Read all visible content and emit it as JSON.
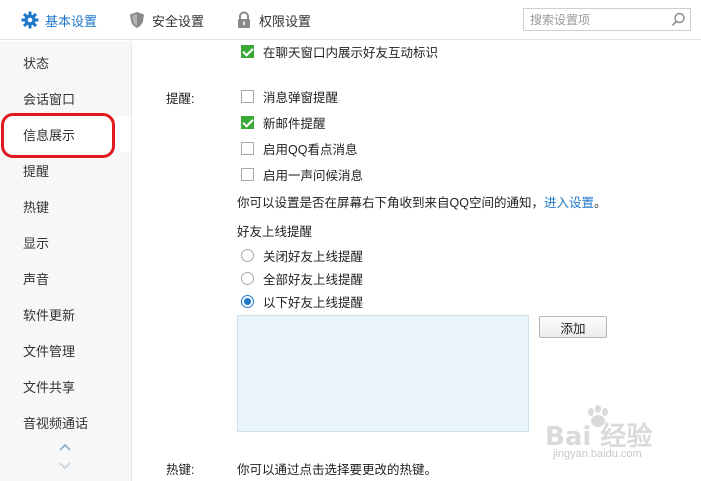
{
  "tabs": [
    {
      "label": "基本设置",
      "icon": "gear-icon",
      "active": true
    },
    {
      "label": "安全设置",
      "icon": "shield-icon",
      "active": false
    },
    {
      "label": "权限设置",
      "icon": "lock-icon",
      "active": false
    }
  ],
  "search": {
    "placeholder": "搜索设置项",
    "icon": "search-icon"
  },
  "sidebar": {
    "items": [
      {
        "label": "状态"
      },
      {
        "label": "会话窗口"
      },
      {
        "label": "信息展示",
        "selected": true
      },
      {
        "label": "提醒"
      },
      {
        "label": "热键"
      },
      {
        "label": "显示"
      },
      {
        "label": "声音"
      },
      {
        "label": "软件更新"
      },
      {
        "label": "文件管理"
      },
      {
        "label": "文件共享"
      },
      {
        "label": "音视频通话"
      }
    ]
  },
  "main": {
    "chat_window_option": {
      "label": "在聊天窗口内展示好友互动标识",
      "checked": true
    },
    "reminder": {
      "section_label": "提醒:",
      "options": [
        {
          "label": "消息弹窗提醒",
          "checked": false
        },
        {
          "label": "新邮件提醒",
          "checked": true
        },
        {
          "label": "启用QQ看点消息",
          "checked": false
        },
        {
          "label": "启用一声问候消息",
          "checked": false
        }
      ],
      "info_text": "你可以设置是否在屏幕右下角收到来自QQ空间的通知，",
      "info_link": "进入设置",
      "info_period": "。"
    },
    "friend_online": {
      "title": "好友上线提醒",
      "options": [
        {
          "label": "关闭好友上线提醒",
          "checked": false
        },
        {
          "label": "全部好友上线提醒",
          "checked": false
        },
        {
          "label": "以下好友上线提醒",
          "checked": true
        }
      ],
      "add_button": "添加"
    },
    "hotkey": {
      "section_label": "热键:",
      "text": "你可以通过点击选择要更改的热键。"
    }
  },
  "watermark": {
    "main": "Bai 经验",
    "sub": "jingyan.baidu.com"
  },
  "colors": {
    "accent": "#1f77c9",
    "check": "#3aa935",
    "annotation": "#e0191f"
  }
}
